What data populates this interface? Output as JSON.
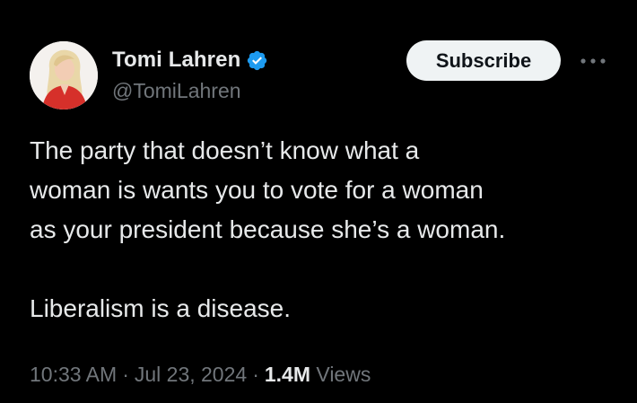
{
  "author": {
    "display_name": "Tomi Lahren",
    "handle": "@TomiLahren",
    "verified": true,
    "verified_color": "#1d9bf0",
    "avatar_icon": "profile-photo"
  },
  "actions": {
    "subscribe_label": "Subscribe",
    "more_icon": "more-horizontal-icon"
  },
  "tweet": {
    "lines": [
      "The party that doesn’t know what a",
      "woman is wants you to vote for a woman",
      "as your president because she’s a woman.",
      "Liberalism is a disease."
    ]
  },
  "meta": {
    "time": "10:33 AM",
    "date": "Jul 23, 2024",
    "separator": "·",
    "views_count": "1.4M",
    "views_label": "Views"
  },
  "colors": {
    "background": "#000000",
    "primary_text": "#e7e9ea",
    "secondary_text": "#71767b",
    "button_bg": "#eff3f4"
  }
}
